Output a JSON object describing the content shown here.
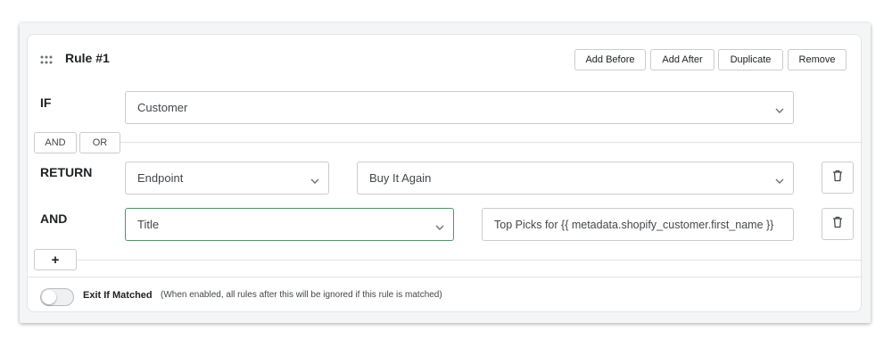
{
  "rule": {
    "title": "Rule #1",
    "actions": {
      "add_before": "Add Before",
      "add_after": "Add After",
      "duplicate": "Duplicate",
      "remove": "Remove"
    },
    "if": {
      "keyword": "IF",
      "selected": "Customer"
    },
    "connectors": {
      "and": "AND",
      "or": "OR"
    },
    "return_row": {
      "keyword": "RETURN",
      "type_selected": "Endpoint",
      "value_selected": "Buy It Again"
    },
    "and_row": {
      "keyword": "AND",
      "field_selected": "Title",
      "value": "Top Picks for {{ metadata.shopify_customer.first_name }}"
    },
    "add_row": "+",
    "exit_if_matched": {
      "label": "Exit If Matched",
      "help": "(When enabled, all rules after this will be ignored if this rule is matched)",
      "enabled": false
    }
  },
  "icons": [
    "drag-handle-icon",
    "chevron-down-icon",
    "trash-icon",
    "plus-icon"
  ],
  "colors": {
    "active_border": "#3aa55c",
    "border": "#c9cccf",
    "text": "#202223"
  }
}
